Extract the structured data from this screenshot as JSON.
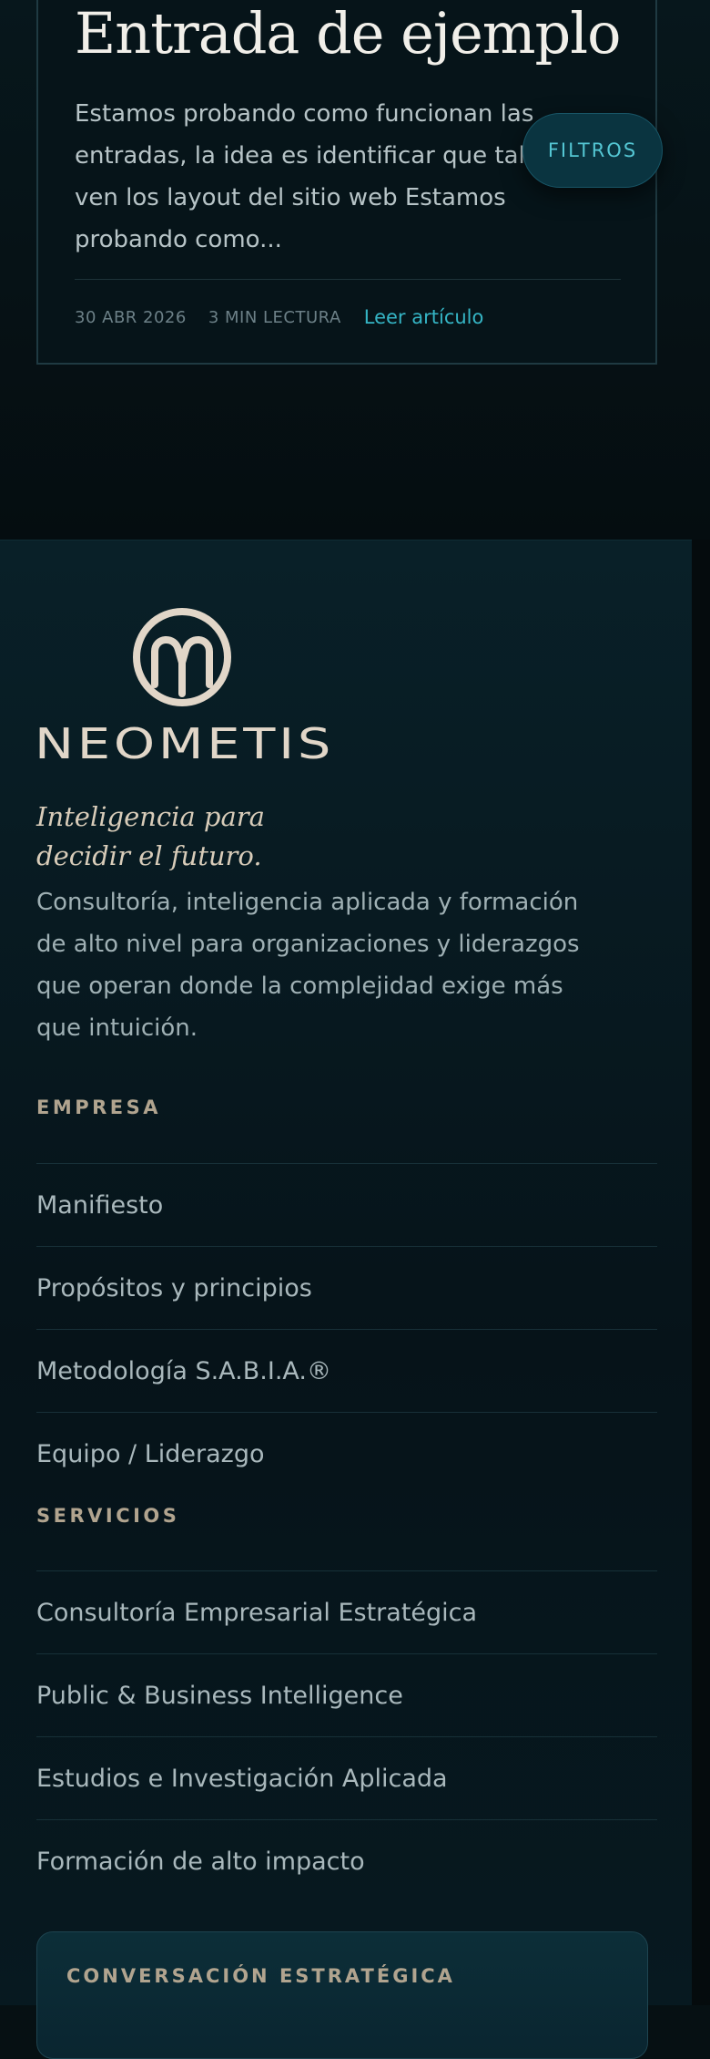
{
  "post": {
    "title": "Entrada de ejemplo",
    "excerpt": "Estamos probando como funcionan las entradas, la idea es identificar que tal se ven los layout del sitio web Estamos probando como...",
    "date": "30 ABR 2026",
    "read_time": "3 MIN LECTURA",
    "read_link": "Leer artículo"
  },
  "filters_button": "FILTROS",
  "footer": {
    "brand": "NEOMETIS",
    "tagline_line1": "Inteligencia para",
    "tagline_line2": "decidir el futuro.",
    "description": "Consultoría, inteligencia aplicada y formación de alto nivel para organizaciones y liderazgos que operan donde la complejidad exige más que intuición.",
    "empresa": {
      "heading": "EMPRESA",
      "items": [
        "Manifiesto",
        "Propósitos y principios",
        "Metodología S.A.B.I.A.®",
        "Equipo / Liderazgo"
      ]
    },
    "servicios": {
      "heading": "SERVICIOS",
      "items": [
        "Consultoría Empresarial Estratégica",
        "Public & Business Intelligence",
        "Estudios e Investigación Aplicada",
        "Formación de alto impacto"
      ]
    },
    "cta_label": "CONVERSACIÓN ESTRATÉGICA"
  },
  "colors": {
    "background": "#061013",
    "accent_teal": "#35b5c5",
    "brand_beige": "#e1d6c8",
    "heading_gold": "#b1a48f"
  },
  "icons": {
    "logo": "neometis-logo-icon"
  }
}
